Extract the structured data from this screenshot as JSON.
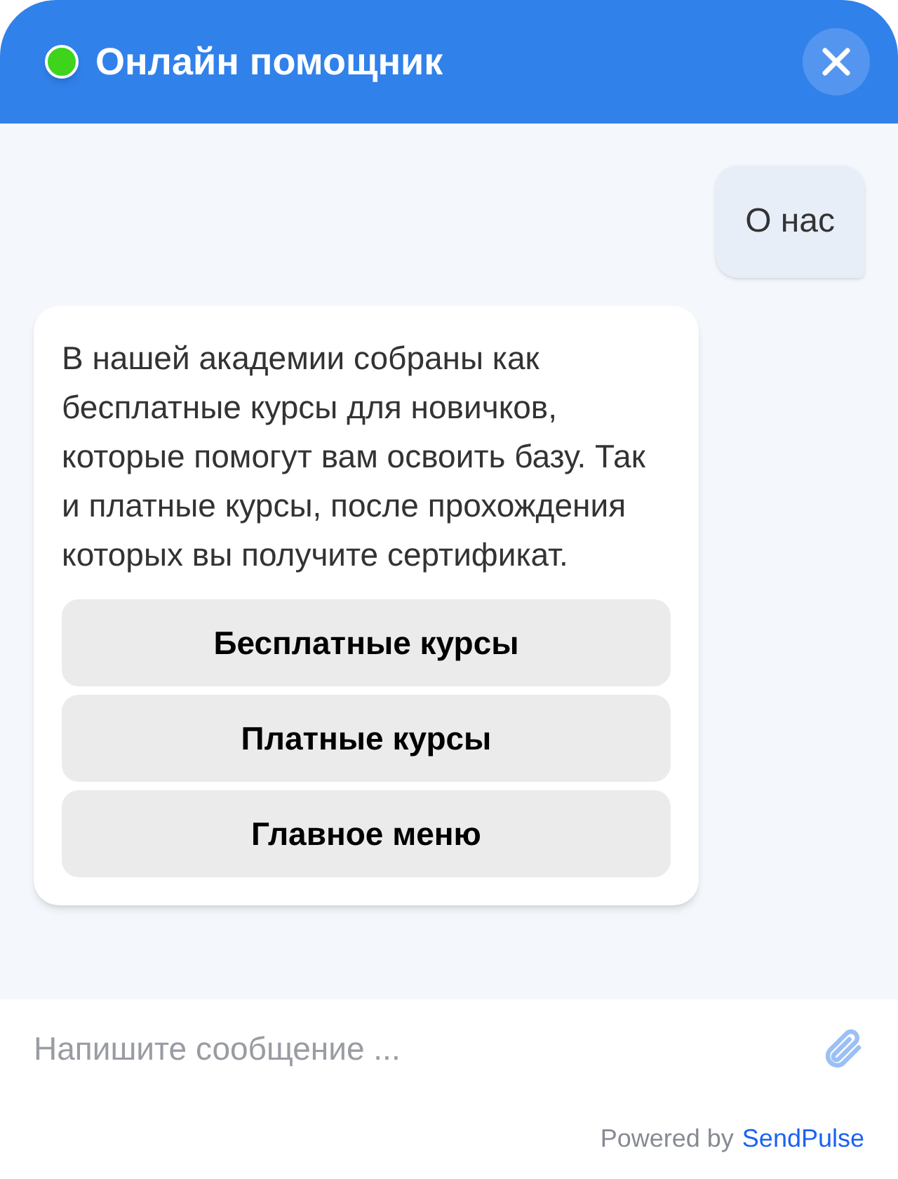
{
  "header": {
    "title": "Онлайн помощник",
    "online": true
  },
  "messages": [
    {
      "kind": "user",
      "text": "О нас"
    },
    {
      "kind": "bot",
      "text": "В нашей академии собраны как бесплатные курсы для новичков, которые помогут вам освоить базу. Так и платные курсы, после прохождения которых вы получите сертификат.",
      "buttons": [
        "Бесплатные курсы",
        "Платные курсы",
        "Главное меню"
      ]
    }
  ],
  "composer": {
    "placeholder": "Напишите сообщение ..."
  },
  "footer": {
    "powered_by": "Powered by",
    "brand_link": "SendPulse"
  }
}
